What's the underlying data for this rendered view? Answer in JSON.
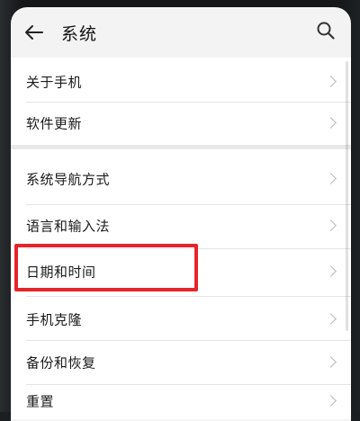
{
  "header": {
    "title": "系统"
  },
  "icons": {
    "back": "arrow-left-icon",
    "search": "search-icon",
    "chevron": "chevron-right-icon"
  },
  "settings": {
    "items": [
      {
        "label": "关于手机"
      },
      {
        "label": "软件更新"
      },
      {
        "label": "系统导航方式"
      },
      {
        "label": "语言和输入法"
      },
      {
        "label": "日期和时间"
      },
      {
        "label": "手机克隆"
      },
      {
        "label": "备份和恢复"
      },
      {
        "label": "重置"
      }
    ],
    "highlighted": "日期和时间"
  },
  "colors": {
    "highlight_border": "#e8242b",
    "background": "#f3f3f3",
    "text": "#1a1a1a"
  }
}
